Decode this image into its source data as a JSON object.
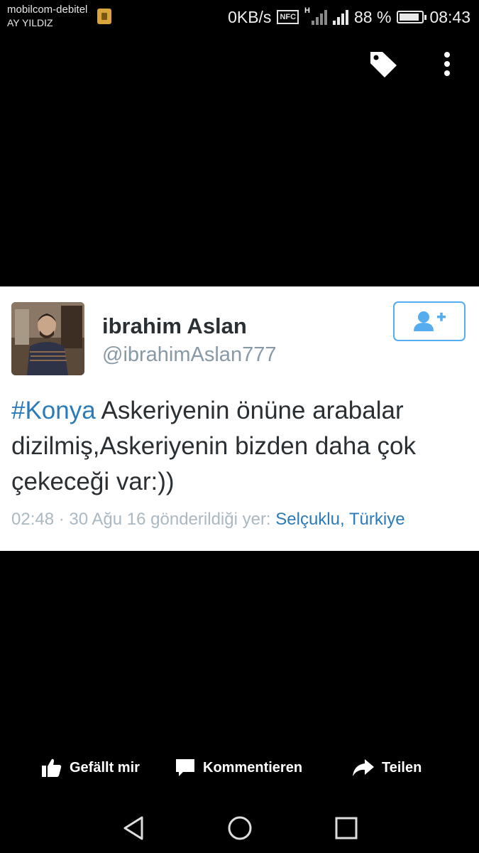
{
  "status_bar": {
    "carrier_line1": "mobilcom-debitel",
    "carrier_line2": "AY YILDIZ",
    "data_speed": "0KB/s",
    "nfc": "NFC",
    "network_type": "H",
    "battery_percent": "88 %",
    "battery_level": 0.88,
    "time": "08:43"
  },
  "top_icons": [
    "tag-icon",
    "more-vert-icon"
  ],
  "tweet": {
    "author_name": "ibrahim Aslan",
    "author_handle": "@ibrahimAslan777",
    "hashtag": "#Konya",
    "text": " Askeriyenin önüne arabalar dizilmiş,Askeriyenin bizden daha çok çekeceği var:))",
    "timestamp": "02:48 · 30 Ağu 16",
    "sent_from_label": " gönderildiği yer: ",
    "location": "Selçuklu, Türkiye",
    "follow_icon": "add-user-icon"
  },
  "actions": {
    "like_label": "Gefällt mir",
    "comment_label": "Kommentieren",
    "share_label": "Teilen"
  },
  "nav_bar": {
    "icons": [
      "back-icon",
      "home-icon",
      "recents-icon"
    ]
  },
  "colors": {
    "accent": "#55acee",
    "link": "#2b7bb9",
    "meta": "#aab8c2",
    "background": "#000000",
    "card": "#ffffff"
  }
}
